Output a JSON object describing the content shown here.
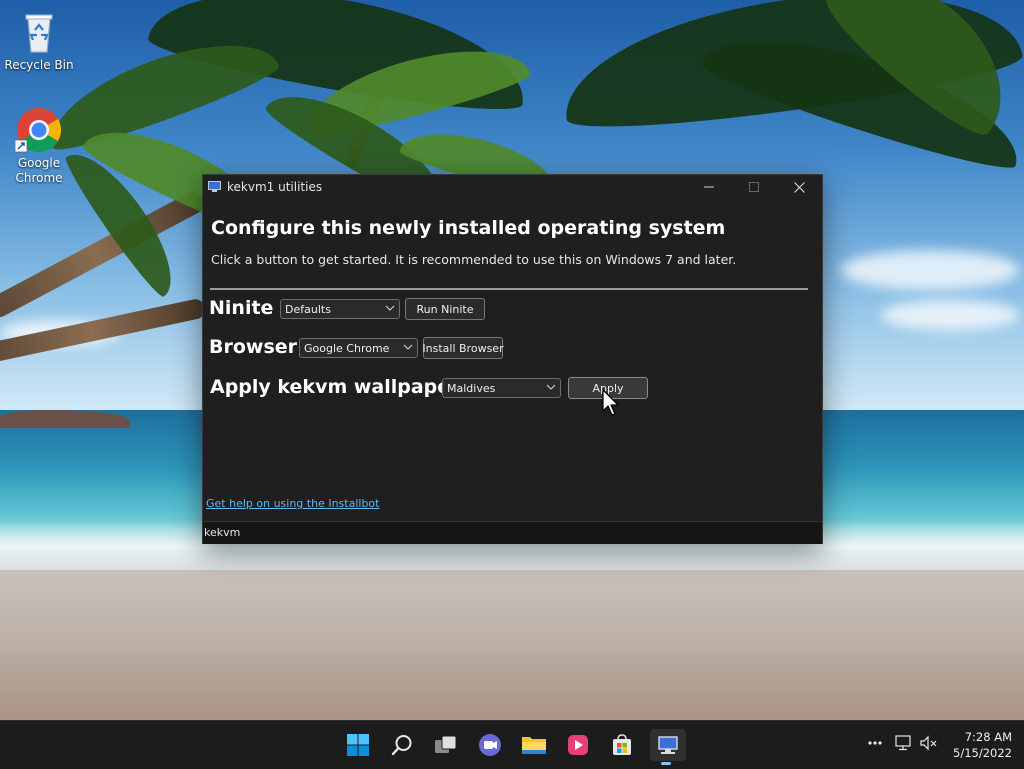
{
  "desktop": {
    "icons": [
      {
        "label": "Recycle Bin",
        "icon": "recycle-bin-icon"
      },
      {
        "label": "Google Chrome",
        "icon": "chrome-icon"
      }
    ]
  },
  "window": {
    "title": "kekvm1 utilities",
    "heading": "Configure this newly installed operating system",
    "subheading": "Click a button to get started. It is recommended to use this on Windows 7 and later.",
    "rows": {
      "ninite": {
        "label": "Ninite",
        "select_value": "Defaults",
        "button_label": "Run Ninite"
      },
      "browser": {
        "label": "Browser",
        "select_value": "Google Chrome",
        "button_label": "Install Browser"
      },
      "wallpaper": {
        "label": "Apply kekvm wallpaper",
        "select_value": "Maldives",
        "button_label": "Apply"
      }
    },
    "help_link": "Get help on using the Installbot",
    "status_text": "kekvm"
  },
  "taskbar": {
    "icons": [
      "start-icon",
      "search-icon",
      "task-view-icon",
      "teams-chat-icon",
      "file-explorer-icon",
      "media-player-icon",
      "microsoft-store-icon",
      "kekvm-utilities-icon"
    ],
    "active_app": "kekvm-utilities-icon",
    "tray": [
      "overflow-icon",
      "network-icon",
      "volume-muted-icon"
    ],
    "time": "7:28 AM",
    "date": "5/15/2022"
  },
  "colors": {
    "window_bg": "#1f1f1f",
    "link": "#5fb8f3",
    "taskbar_bg": "#1c1c1c",
    "accent": "#7fc6ff"
  }
}
